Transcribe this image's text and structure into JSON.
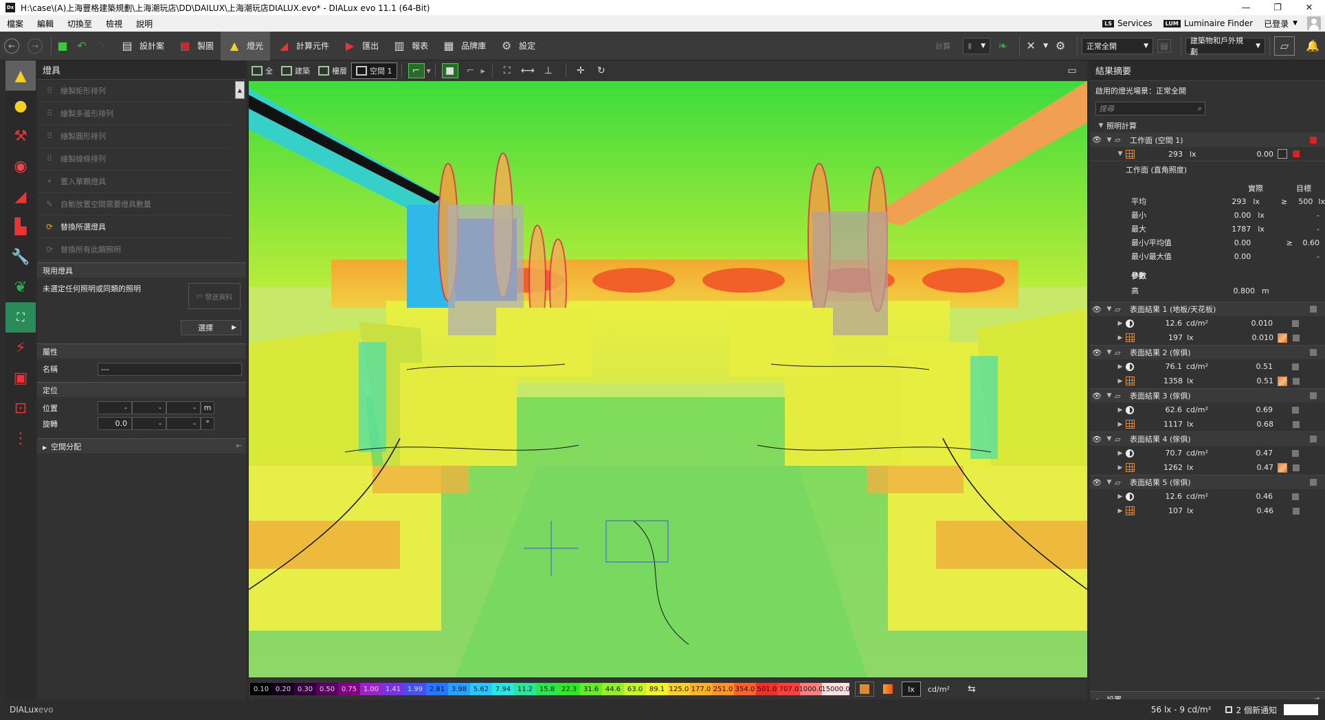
{
  "window": {
    "title": "H:\\case\\(A)上海豐格建築規劃\\上海潮玩店\\DD\\DAILUX\\上海潮玩店DIALUX.evo* - DIALux evo 11.1  (64-Bit)",
    "app_icon": "Dx"
  },
  "menu": {
    "items": [
      "檔案",
      "編輯",
      "切換至",
      "檢視",
      "說明"
    ],
    "services_badge": "LS",
    "services": "Services",
    "luminaire_badge": "LUM",
    "luminaire_finder": "Luminaire Finder",
    "login": "已登录"
  },
  "toolbar": {
    "buttons": [
      "設計案",
      "製圖",
      "燈光",
      "計算元件",
      "匯出",
      "報表",
      "品牌庫",
      "設定"
    ],
    "calc_label": "計算",
    "scene_dropdown": "正常全開",
    "mode_dropdown": "建築物和戶外規劃"
  },
  "left_panel": {
    "title": "燈具",
    "items": [
      "繪製矩形排列",
      "繪製多邊形排列",
      "繪製圓形排列",
      "繪製線條排列",
      "置入單顆燈具",
      "自動放置空間需要燈具數量",
      "替換所選燈具",
      "替換所有此類照明"
    ],
    "current_section": "現用燈具",
    "current_text": "未選定任何照明或同類的照明",
    "send_button": "發送資料",
    "select_button": "選擇",
    "props_section": "屬性",
    "name_label": "名稱",
    "name_value": "---",
    "position_section": "定位",
    "position_label": "位置",
    "position_values": [
      "-",
      "-",
      "-"
    ],
    "position_unit": "m",
    "rotation_label": "旋轉",
    "rotation_values": [
      "0.0",
      "-",
      "-"
    ],
    "rotation_unit": "°",
    "space_dist": "空間分配"
  },
  "viewport_toolbar": {
    "tabs": [
      "全",
      "建築",
      "樓層",
      "空間 1"
    ]
  },
  "legend": {
    "values": [
      "0.10",
      "0.20",
      "0.30",
      "0.50",
      "0.75",
      "1.00",
      "1.41",
      "1.99",
      "2.81",
      "3.98",
      "5.62",
      "7.94",
      "11.2",
      "15.8",
      "22.3",
      "31.6",
      "44.6",
      "63.0",
      "89.1",
      "125.0",
      "177.0",
      "251.0",
      "354.0",
      "501.0",
      "707.0",
      "1000.0",
      "15000.0"
    ],
    "colors": [
      "#000000",
      "#14001e",
      "#32003c",
      "#55005f",
      "#800080",
      "#9b23c8",
      "#7832e6",
      "#4650f0",
      "#2878ff",
      "#28a0ff",
      "#28c8ff",
      "#28e6e6",
      "#28e6a0",
      "#28e650",
      "#32e628",
      "#64ec28",
      "#96f028",
      "#c8f528",
      "#f0f528",
      "#fad228",
      "#fab428",
      "#fa9628",
      "#fa6428",
      "#f03228",
      "#ff4040",
      "#ff8080",
      "#ffe0e0"
    ],
    "unit_lx": "lx",
    "unit_cd": "cd/m²"
  },
  "right_panel": {
    "title": "結果摘要",
    "scene_text": "啟用的燈光場景：正常全開",
    "search_placeholder": "搜尋",
    "calc_section": "照明計算",
    "workplane": {
      "name": "工作面 (空間 1)",
      "value": "293",
      "unit": "lx",
      "ratio": "0.00",
      "sub_title": "工作面 (直角照度)",
      "col_actual": "實際",
      "col_target": "目標",
      "rows": [
        {
          "label": "平均",
          "value": "293",
          "unit": "lx",
          "op": "≥",
          "target": "500",
          "tunit": "lx"
        },
        {
          "label": "最小",
          "value": "0.00",
          "unit": "lx",
          "op": "",
          "target": "-",
          "tunit": ""
        },
        {
          "label": "最大",
          "value": "1787",
          "unit": "lx",
          "op": "",
          "target": "-",
          "tunit": ""
        },
        {
          "label": "最小/平均值",
          "value": "0.00",
          "unit": "",
          "op": "≥",
          "target": "0.60",
          "tunit": ""
        },
        {
          "label": "最小/最大值",
          "value": "0.00",
          "unit": "",
          "op": "",
          "target": "-",
          "tunit": ""
        }
      ],
      "params_title": "參數",
      "height_label": "高",
      "height_value": "0.800",
      "height_unit": "m"
    },
    "surfaces": [
      {
        "name": "表面結果 1 (地板/天花板)",
        "lum": "12.6",
        "lum_unit": "cd/m²",
        "lum_ratio": "0.010",
        "ill": "197",
        "ill_unit": "lx",
        "ill_ratio": "0.010",
        "thumb": true
      },
      {
        "name": "表面結果 2 (傢俱)",
        "lum": "76.1",
        "lum_unit": "cd/m²",
        "lum_ratio": "0.51",
        "ill": "1358",
        "ill_unit": "lx",
        "ill_ratio": "0.51",
        "thumb": true
      },
      {
        "name": "表面結果 3 (傢俱)",
        "lum": "62.6",
        "lum_unit": "cd/m²",
        "lum_ratio": "0.69",
        "ill": "1117",
        "ill_unit": "lx",
        "ill_ratio": "0.68",
        "thumb": false
      },
      {
        "name": "表面結果 4 (傢俱)",
        "lum": "70.7",
        "lum_unit": "cd/m²",
        "lum_ratio": "0.47",
        "ill": "1262",
        "ill_unit": "lx",
        "ill_ratio": "0.47",
        "thumb": true
      },
      {
        "name": "表面結果 5 (傢俱)",
        "lum": "12.6",
        "lum_unit": "cd/m²",
        "lum_ratio": "0.46",
        "ill": "107",
        "ill_unit": "lx",
        "ill_ratio": "0.46",
        "thumb": false
      }
    ],
    "settings": "設置"
  },
  "status": {
    "logo": "DIALux",
    "logo_suffix": "evo",
    "readout": "56 lx - 9 cd/m²",
    "notifications": "2 個新通知"
  },
  "colors": {
    "accent_yellow": "#f5d21e",
    "accent_orange": "#e08a30",
    "alert_red": "#e02020"
  }
}
